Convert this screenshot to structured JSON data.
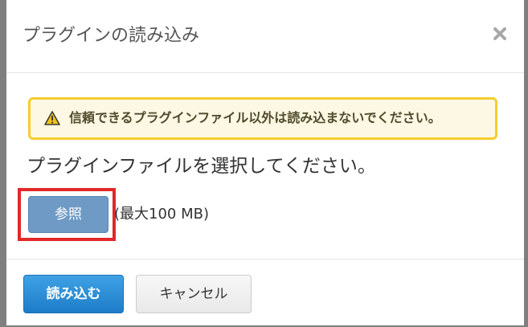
{
  "dialog": {
    "title": "プラグインの読み込み",
    "close_icon": "close-icon"
  },
  "alert": {
    "icon": "warning-icon",
    "text": "信頼できるプラグインファイル以外は読み込まないでください。",
    "border_color": "#f5cd2f",
    "background_color": "#fcf8e3"
  },
  "body": {
    "instruction": "プラグインファイルを選択してください。",
    "browse_label": "参照",
    "file_size_note": "(最大100 MB)",
    "highlight_color": "#e22828"
  },
  "footer": {
    "import_label": "読み込む",
    "cancel_label": "キャンセル",
    "primary_color": "#2b8fd9"
  }
}
